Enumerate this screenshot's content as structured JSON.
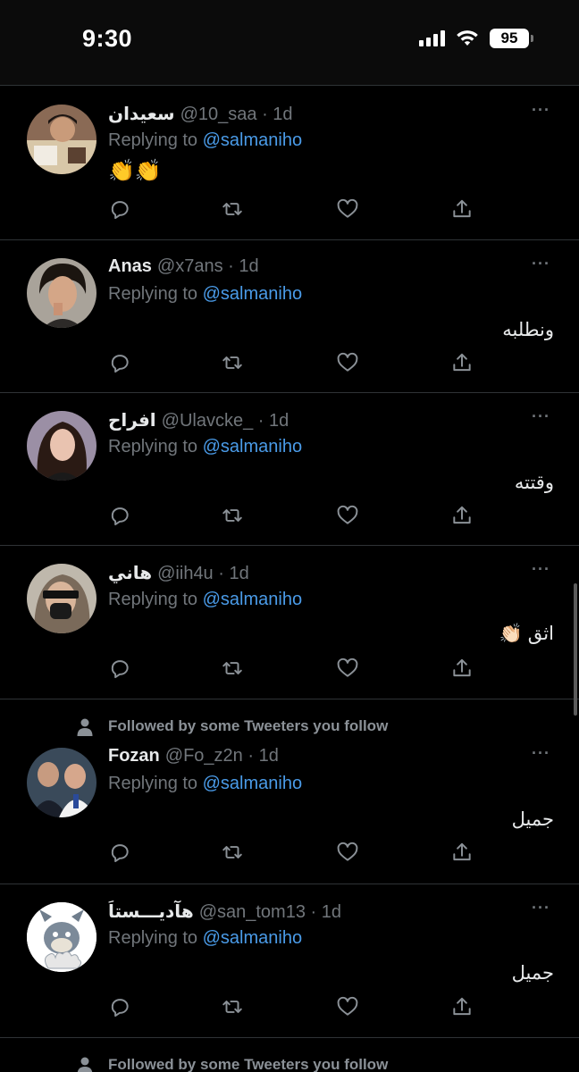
{
  "status_bar": {
    "time": "9:30",
    "battery": "95"
  },
  "reply_prefix": "Replying to ",
  "more_label": "···",
  "tweets": [
    {
      "name": "سعيدان",
      "handle": "@10_saa · 1d",
      "mention": "@salmaniho",
      "text": "👏👏",
      "social": ""
    },
    {
      "name": "Anas",
      "handle": "@x7ans · 1d",
      "mention": "@salmaniho",
      "text": "ونطلبه",
      "social": ""
    },
    {
      "name": "افراح",
      "handle": "@Ulavcke_ · 1d",
      "mention": "@salmaniho",
      "text": "وقتته",
      "social": ""
    },
    {
      "name": "هاني",
      "handle": "@iih4u · 1d",
      "mention": "@salmaniho",
      "text": "اثق 👏🏻",
      "social": ""
    },
    {
      "name": "Fozan",
      "handle": "@Fo_z2n · 1d",
      "mention": "@salmaniho",
      "text": "جميل",
      "social": "Followed by some Tweeters you follow"
    },
    {
      "name": "هآديـــستاَ",
      "handle": "@san_tom13 · 1d",
      "mention": "@salmaniho",
      "text": "جميل",
      "social": ""
    }
  ],
  "bottom_social": "Followed by some Tweeters you follow",
  "colors": {
    "background": "#000000",
    "accent": "#4a9be8",
    "muted": "#71767b",
    "divider": "#2f3336"
  },
  "icons": [
    "reply-icon",
    "retweet-icon",
    "like-icon",
    "share-icon",
    "more-icon",
    "person-icon",
    "wifi-icon",
    "signal-icon",
    "battery-icon"
  ]
}
